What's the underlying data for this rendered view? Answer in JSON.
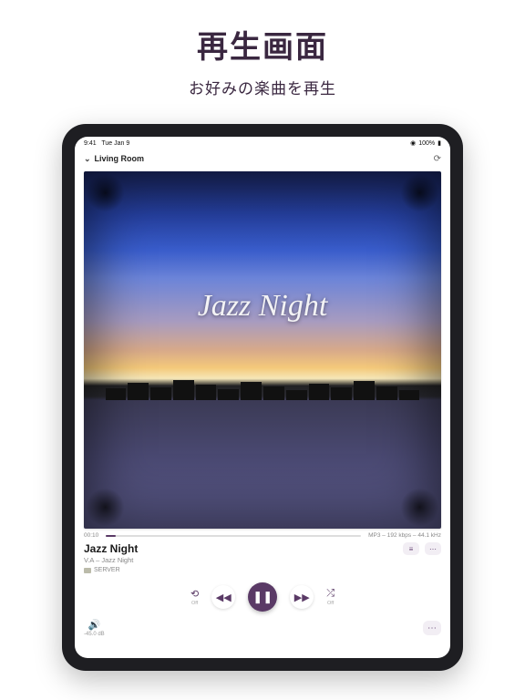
{
  "promo": {
    "title": "再生画面",
    "subtitle": "お好みの楽曲を再生"
  },
  "status": {
    "time": "9:41",
    "date": "Tue Jan 9",
    "battery": "100%"
  },
  "header": {
    "room": "Living Room"
  },
  "album": {
    "art_title": "Jazz Night"
  },
  "progress": {
    "elapsed": "00:10",
    "format": "MP3 – 192 kbps – 44.1 kHz"
  },
  "track": {
    "title": "Jazz Night",
    "subtitle": "V.A – Jazz Night",
    "source": "SERVER"
  },
  "controls": {
    "repeat_label": "Off",
    "shuffle_label": "Off"
  },
  "volume": {
    "db": "-45.0 dB"
  },
  "icons": {
    "chevron_down": "⌄",
    "loop": "⟳",
    "queue": "≡",
    "more": "⋯",
    "repeat": "⟲",
    "prev": "◀◀",
    "pause": "❚❚",
    "next": "▶▶",
    "shuffle": "⤮",
    "volume": "🔊",
    "server": "▣",
    "ellipsis": "⋯",
    "wifi": "◉",
    "battery": "▮"
  }
}
